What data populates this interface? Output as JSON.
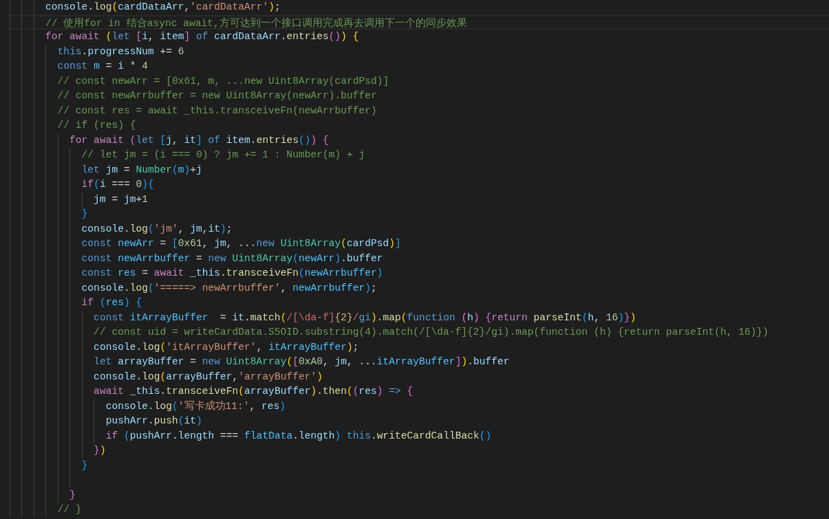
{
  "lines": [
    {
      "current": false,
      "tokens": [
        {
          "text": "        console",
          "kind": "var"
        },
        {
          "text": ".",
          "kind": "op"
        },
        {
          "text": "log",
          "kind": "fn"
        },
        {
          "text": "(",
          "kind": "b1"
        },
        {
          "text": "cardDataArr",
          "kind": "var"
        },
        {
          "text": ",",
          "kind": "op"
        },
        {
          "text": "'cardDataArr'",
          "kind": "str"
        },
        {
          "text": ")",
          "kind": "b1"
        },
        {
          "text": ";",
          "kind": "op"
        }
      ]
    },
    {
      "current": true,
      "tokens": [
        {
          "text": "        // 使用for in 结合async await,方可达到一个接口调用完成再去调用下一个的同步效果",
          "kind": "cmt"
        }
      ]
    },
    {
      "current": false,
      "tokens": [
        {
          "text": "        for await ",
          "kind": "ctl"
        },
        {
          "text": "(",
          "kind": "b1"
        },
        {
          "text": "let ",
          "kind": "kw"
        },
        {
          "text": "[",
          "kind": "b2"
        },
        {
          "text": "i",
          "kind": "var"
        },
        {
          "text": ", ",
          "kind": "op"
        },
        {
          "text": "item",
          "kind": "var"
        },
        {
          "text": "]",
          "kind": "b2"
        },
        {
          "text": " of ",
          "kind": "kw"
        },
        {
          "text": "cardDataArr",
          "kind": "var"
        },
        {
          "text": ".",
          "kind": "op"
        },
        {
          "text": "entries",
          "kind": "fn"
        },
        {
          "text": "()",
          "kind": "b2"
        },
        {
          "text": ") ",
          "kind": "b1"
        },
        {
          "text": "{",
          "kind": "b1"
        }
      ]
    },
    {
      "current": false,
      "tokens": [
        {
          "text": "          this",
          "kind": "kw"
        },
        {
          "text": ".",
          "kind": "op"
        },
        {
          "text": "progressNum",
          "kind": "var"
        },
        {
          "text": " += ",
          "kind": "op"
        },
        {
          "text": "6",
          "kind": "num"
        }
      ]
    },
    {
      "current": false,
      "tokens": [
        {
          "text": "          const ",
          "kind": "kw"
        },
        {
          "text": "m",
          "kind": "const"
        },
        {
          "text": " = ",
          "kind": "op"
        },
        {
          "text": "i",
          "kind": "var"
        },
        {
          "text": " * ",
          "kind": "op"
        },
        {
          "text": "4",
          "kind": "num"
        }
      ]
    },
    {
      "current": false,
      "tokens": [
        {
          "text": "          // const newArr = [0x61, m, ...new Uint8Array(cardPsd)]",
          "kind": "cmt"
        }
      ]
    },
    {
      "current": false,
      "tokens": [
        {
          "text": "          // const newArrbuffer = new Uint8Array(newArr).buffer",
          "kind": "cmt"
        }
      ]
    },
    {
      "current": false,
      "tokens": [
        {
          "text": "          // const res = await _this.transceiveFn(newArrbuffer)",
          "kind": "cmt"
        }
      ]
    },
    {
      "current": false,
      "tokens": [
        {
          "text": "          // if (res) {",
          "kind": "cmt"
        }
      ]
    },
    {
      "current": false,
      "tokens": [
        {
          "text": "            for await ",
          "kind": "ctl"
        },
        {
          "text": "(",
          "kind": "b2"
        },
        {
          "text": "let ",
          "kind": "kw"
        },
        {
          "text": "[",
          "kind": "b3"
        },
        {
          "text": "j",
          "kind": "var"
        },
        {
          "text": ", ",
          "kind": "op"
        },
        {
          "text": "it",
          "kind": "var"
        },
        {
          "text": "]",
          "kind": "b3"
        },
        {
          "text": " of ",
          "kind": "kw"
        },
        {
          "text": "item",
          "kind": "var"
        },
        {
          "text": ".",
          "kind": "op"
        },
        {
          "text": "entries",
          "kind": "fn"
        },
        {
          "text": "()",
          "kind": "b3"
        },
        {
          "text": ") ",
          "kind": "b2"
        },
        {
          "text": "{",
          "kind": "b2"
        }
      ]
    },
    {
      "current": false,
      "tokens": [
        {
          "text": "              // let jm = (i === 0) ? jm += 1 : Number(m) + j",
          "kind": "cmt"
        }
      ]
    },
    {
      "current": false,
      "tokens": [
        {
          "text": "              let ",
          "kind": "kw"
        },
        {
          "text": "jm",
          "kind": "var"
        },
        {
          "text": " = ",
          "kind": "op"
        },
        {
          "text": "Number",
          "kind": "type"
        },
        {
          "text": "(",
          "kind": "b3"
        },
        {
          "text": "m",
          "kind": "const"
        },
        {
          "text": ")",
          "kind": "b3"
        },
        {
          "text": "+",
          "kind": "op"
        },
        {
          "text": "j",
          "kind": "var"
        }
      ]
    },
    {
      "current": false,
      "tokens": [
        {
          "text": "              if",
          "kind": "ctl"
        },
        {
          "text": "(",
          "kind": "b3"
        },
        {
          "text": "i",
          "kind": "var"
        },
        {
          "text": " === ",
          "kind": "op"
        },
        {
          "text": "0",
          "kind": "num"
        },
        {
          "text": ")",
          "kind": "b3"
        },
        {
          "text": "{",
          "kind": "b3"
        }
      ]
    },
    {
      "current": false,
      "tokens": [
        {
          "text": "                jm",
          "kind": "var"
        },
        {
          "text": " = ",
          "kind": "op"
        },
        {
          "text": "jm",
          "kind": "var"
        },
        {
          "text": "+",
          "kind": "op"
        },
        {
          "text": "1",
          "kind": "num"
        }
      ]
    },
    {
      "current": false,
      "tokens": [
        {
          "text": "              }",
          "kind": "b3"
        }
      ]
    },
    {
      "current": false,
      "tokens": [
        {
          "text": "              console",
          "kind": "var"
        },
        {
          "text": ".",
          "kind": "op"
        },
        {
          "text": "log",
          "kind": "fn"
        },
        {
          "text": "(",
          "kind": "b3"
        },
        {
          "text": "'jm'",
          "kind": "str"
        },
        {
          "text": ", ",
          "kind": "op"
        },
        {
          "text": "jm",
          "kind": "var"
        },
        {
          "text": ",",
          "kind": "op"
        },
        {
          "text": "it",
          "kind": "var"
        },
        {
          "text": ")",
          "kind": "b3"
        },
        {
          "text": ";",
          "kind": "op"
        }
      ]
    },
    {
      "current": false,
      "tokens": [
        {
          "text": "              const ",
          "kind": "kw"
        },
        {
          "text": "newArr",
          "kind": "const"
        },
        {
          "text": " = ",
          "kind": "op"
        },
        {
          "text": "[",
          "kind": "b3"
        },
        {
          "text": "0x61",
          "kind": "num"
        },
        {
          "text": ", ",
          "kind": "op"
        },
        {
          "text": "jm",
          "kind": "var"
        },
        {
          "text": ", ...",
          "kind": "op"
        },
        {
          "text": "new ",
          "kind": "kw"
        },
        {
          "text": "Uint8Array",
          "kind": "type"
        },
        {
          "text": "(",
          "kind": "b1"
        },
        {
          "text": "cardPsd",
          "kind": "var"
        },
        {
          "text": ")",
          "kind": "b1"
        },
        {
          "text": "]",
          "kind": "b3"
        }
      ]
    },
    {
      "current": false,
      "tokens": [
        {
          "text": "              const ",
          "kind": "kw"
        },
        {
          "text": "newArrbuffer",
          "kind": "const"
        },
        {
          "text": " = ",
          "kind": "op"
        },
        {
          "text": "new ",
          "kind": "kw"
        },
        {
          "text": "Uint8Array",
          "kind": "type"
        },
        {
          "text": "(",
          "kind": "b3"
        },
        {
          "text": "newArr",
          "kind": "const"
        },
        {
          "text": ")",
          "kind": "b3"
        },
        {
          "text": ".",
          "kind": "op"
        },
        {
          "text": "buffer",
          "kind": "var"
        }
      ]
    },
    {
      "current": false,
      "tokens": [
        {
          "text": "              const ",
          "kind": "kw"
        },
        {
          "text": "res",
          "kind": "const"
        },
        {
          "text": " = ",
          "kind": "op"
        },
        {
          "text": "await ",
          "kind": "ctl"
        },
        {
          "text": "_this",
          "kind": "var"
        },
        {
          "text": ".",
          "kind": "op"
        },
        {
          "text": "transceiveFn",
          "kind": "fn"
        },
        {
          "text": "(",
          "kind": "b3"
        },
        {
          "text": "newArrbuffer",
          "kind": "const"
        },
        {
          "text": ")",
          "kind": "b3"
        }
      ]
    },
    {
      "current": false,
      "tokens": [
        {
          "text": "              console",
          "kind": "var"
        },
        {
          "text": ".",
          "kind": "op"
        },
        {
          "text": "log",
          "kind": "fn"
        },
        {
          "text": "(",
          "kind": "b3"
        },
        {
          "text": "'=====> newArrbuffer'",
          "kind": "str"
        },
        {
          "text": ", ",
          "kind": "op"
        },
        {
          "text": "newArrbuffer",
          "kind": "const"
        },
        {
          "text": ")",
          "kind": "b3"
        },
        {
          "text": ";",
          "kind": "op"
        }
      ]
    },
    {
      "current": false,
      "tokens": [
        {
          "text": "              if ",
          "kind": "ctl"
        },
        {
          "text": "(",
          "kind": "b3"
        },
        {
          "text": "res",
          "kind": "const"
        },
        {
          "text": ") ",
          "kind": "b3"
        },
        {
          "text": "{",
          "kind": "b3"
        }
      ]
    },
    {
      "current": false,
      "tokens": [
        {
          "text": "                const ",
          "kind": "kw"
        },
        {
          "text": "itArrayBuffer",
          "kind": "const"
        },
        {
          "text": "  = ",
          "kind": "op"
        },
        {
          "text": "it",
          "kind": "var"
        },
        {
          "text": ".",
          "kind": "op"
        },
        {
          "text": "match",
          "kind": "fn"
        },
        {
          "text": "(",
          "kind": "b1"
        },
        {
          "text": "/[\\da-f]",
          "kind": "re"
        },
        {
          "text": "{2}",
          "kind": "req"
        },
        {
          "text": "/",
          "kind": "re"
        },
        {
          "text": "gi",
          "kind": "kw"
        },
        {
          "text": ")",
          "kind": "b1"
        },
        {
          "text": ".",
          "kind": "op"
        },
        {
          "text": "map",
          "kind": "fn"
        },
        {
          "text": "(",
          "kind": "b1"
        },
        {
          "text": "function ",
          "kind": "kw"
        },
        {
          "text": "(",
          "kind": "b2"
        },
        {
          "text": "h",
          "kind": "var"
        },
        {
          "text": ") ",
          "kind": "b2"
        },
        {
          "text": "{",
          "kind": "b2"
        },
        {
          "text": "return ",
          "kind": "ctl"
        },
        {
          "text": "parseInt",
          "kind": "fn"
        },
        {
          "text": "(",
          "kind": "b3"
        },
        {
          "text": "h",
          "kind": "var"
        },
        {
          "text": ", ",
          "kind": "op"
        },
        {
          "text": "16",
          "kind": "num"
        },
        {
          "text": ")",
          "kind": "b3"
        },
        {
          "text": "}",
          "kind": "b2"
        },
        {
          "text": ")",
          "kind": "b1"
        }
      ]
    },
    {
      "current": false,
      "tokens": [
        {
          "text": "                // const uid = writeCardData.S5OID.substring(4).match(/[\\da-f]{2}/gi).map(function (h) {return parseInt(h, 16)})",
          "kind": "cmt"
        }
      ]
    },
    {
      "current": false,
      "tokens": [
        {
          "text": "                console",
          "kind": "var"
        },
        {
          "text": ".",
          "kind": "op"
        },
        {
          "text": "log",
          "kind": "fn"
        },
        {
          "text": "(",
          "kind": "b1"
        },
        {
          "text": "'itArrayBuffer'",
          "kind": "str"
        },
        {
          "text": ", ",
          "kind": "op"
        },
        {
          "text": "itArrayBuffer",
          "kind": "const"
        },
        {
          "text": ")",
          "kind": "b1"
        },
        {
          "text": ";",
          "kind": "op"
        }
      ]
    },
    {
      "current": false,
      "tokens": [
        {
          "text": "                let ",
          "kind": "kw"
        },
        {
          "text": "arrayBuffer",
          "kind": "var"
        },
        {
          "text": " = ",
          "kind": "op"
        },
        {
          "text": "new ",
          "kind": "kw"
        },
        {
          "text": "Uint8Array",
          "kind": "type"
        },
        {
          "text": "(",
          "kind": "b1"
        },
        {
          "text": "[",
          "kind": "b2"
        },
        {
          "text": "0xA0",
          "kind": "num"
        },
        {
          "text": ", ",
          "kind": "op"
        },
        {
          "text": "jm",
          "kind": "var"
        },
        {
          "text": ", ...",
          "kind": "op"
        },
        {
          "text": "itArrayBuffer",
          "kind": "const"
        },
        {
          "text": "]",
          "kind": "b2"
        },
        {
          "text": ")",
          "kind": "b1"
        },
        {
          "text": ".",
          "kind": "op"
        },
        {
          "text": "buffer",
          "kind": "var"
        }
      ]
    },
    {
      "current": false,
      "tokens": [
        {
          "text": "                console",
          "kind": "var"
        },
        {
          "text": ".",
          "kind": "op"
        },
        {
          "text": "log",
          "kind": "fn"
        },
        {
          "text": "(",
          "kind": "b1"
        },
        {
          "text": "arrayBuffer",
          "kind": "var"
        },
        {
          "text": ",",
          "kind": "op"
        },
        {
          "text": "'arrayBuffer'",
          "kind": "str"
        },
        {
          "text": ")",
          "kind": "b1"
        }
      ]
    },
    {
      "current": false,
      "tokens": [
        {
          "text": "                await ",
          "kind": "ctl"
        },
        {
          "text": "_this",
          "kind": "var"
        },
        {
          "text": ".",
          "kind": "op"
        },
        {
          "text": "transceiveFn",
          "kind": "fn"
        },
        {
          "text": "(",
          "kind": "b1"
        },
        {
          "text": "arrayBuffer",
          "kind": "var"
        },
        {
          "text": ")",
          "kind": "b1"
        },
        {
          "text": ".",
          "kind": "op"
        },
        {
          "text": "then",
          "kind": "fn"
        },
        {
          "text": "(",
          "kind": "b1"
        },
        {
          "text": "(",
          "kind": "b2"
        },
        {
          "text": "res",
          "kind": "var"
        },
        {
          "text": ")",
          "kind": "b2"
        },
        {
          "text": " => ",
          "kind": "kw"
        },
        {
          "text": "{",
          "kind": "b2"
        }
      ]
    },
    {
      "current": false,
      "tokens": [
        {
          "text": "                  console",
          "kind": "var"
        },
        {
          "text": ".",
          "kind": "op"
        },
        {
          "text": "log",
          "kind": "fn"
        },
        {
          "text": "(",
          "kind": "b3"
        },
        {
          "text": "'写卡成功11:'",
          "kind": "str"
        },
        {
          "text": ", ",
          "kind": "op"
        },
        {
          "text": "res",
          "kind": "var"
        },
        {
          "text": ")",
          "kind": "b3"
        }
      ]
    },
    {
      "current": false,
      "tokens": [
        {
          "text": "                  pushArr",
          "kind": "var"
        },
        {
          "text": ".",
          "kind": "op"
        },
        {
          "text": "push",
          "kind": "fn"
        },
        {
          "text": "(",
          "kind": "b3"
        },
        {
          "text": "it",
          "kind": "var"
        },
        {
          "text": ")",
          "kind": "b3"
        }
      ]
    },
    {
      "current": false,
      "tokens": [
        {
          "text": "                  if ",
          "kind": "ctl"
        },
        {
          "text": "(",
          "kind": "b3"
        },
        {
          "text": "pushArr",
          "kind": "var"
        },
        {
          "text": ".",
          "kind": "op"
        },
        {
          "text": "length",
          "kind": "var"
        },
        {
          "text": " === ",
          "kind": "op"
        },
        {
          "text": "flatData",
          "kind": "const"
        },
        {
          "text": ".",
          "kind": "op"
        },
        {
          "text": "length",
          "kind": "var"
        },
        {
          "text": ") ",
          "kind": "b3"
        },
        {
          "text": "this",
          "kind": "kw"
        },
        {
          "text": ".",
          "kind": "op"
        },
        {
          "text": "writeCardCallBack",
          "kind": "fn"
        },
        {
          "text": "()",
          "kind": "b3"
        }
      ]
    },
    {
      "current": false,
      "tokens": [
        {
          "text": "                }",
          "kind": "b2"
        },
        {
          "text": ")",
          "kind": "b1"
        }
      ]
    },
    {
      "current": false,
      "tokens": [
        {
          "text": "              }",
          "kind": "b3"
        }
      ]
    },
    {
      "current": false
    },
    {
      "current": false,
      "tokens": [
        {
          "text": "            }",
          "kind": "b2"
        }
      ]
    },
    {
      "current": false,
      "tokens": [
        {
          "text": "          // }",
          "kind": "cmt"
        }
      ]
    }
  ]
}
